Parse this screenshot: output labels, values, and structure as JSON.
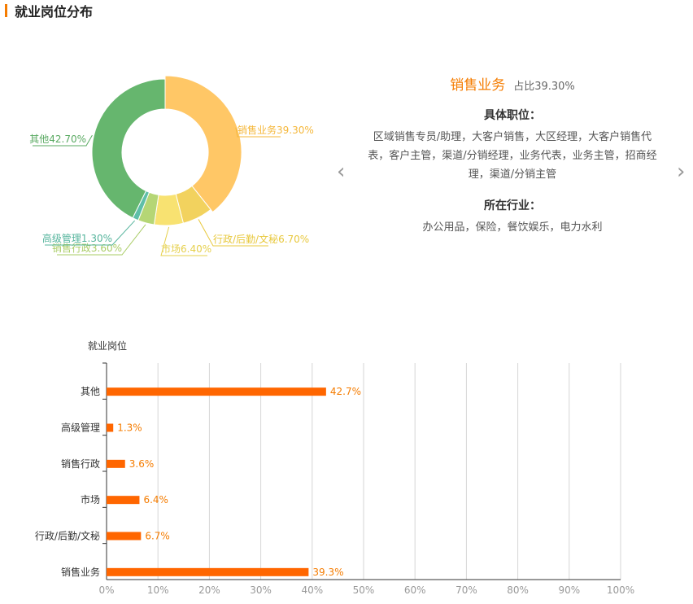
{
  "section": {
    "title": "就业岗位分布"
  },
  "colors": {
    "accent": "#f57c00",
    "bar": "#ff6600"
  },
  "chart_data": [
    {
      "type": "pie",
      "variant": "donut",
      "slices": [
        {
          "name": "销售业务",
          "value": 39.3,
          "label": "销售业务39.30%",
          "color": "#ffc766",
          "label_color": "#f5b73a"
        },
        {
          "name": "行政/后勤/文秘",
          "value": 6.7,
          "label": "行政/后勤/文秘6.70%",
          "color": "#f2d25e",
          "label_color": "#e8c83c"
        },
        {
          "name": "市场",
          "value": 6.4,
          "label": "市场6.40%",
          "color": "#f8e271",
          "label_color": "#e6d04c"
        },
        {
          "name": "销售行政",
          "value": 3.6,
          "label": "销售行政3.60%",
          "color": "#b5d675",
          "label_color": "#a9cc65"
        },
        {
          "name": "高级管理",
          "value": 1.3,
          "label": "高级管理1.30%",
          "color": "#5fbfa8",
          "label_color": "#55b49c"
        },
        {
          "name": "其他",
          "value": 42.7,
          "label": "其他42.70%",
          "color": "#66b66e",
          "label_color": "#5aaa62"
        }
      ]
    },
    {
      "type": "bar",
      "orientation": "horizontal",
      "ylabel": "就业岗位",
      "categories": [
        "其他",
        "高级管理",
        "销售行政",
        "市场",
        "行政/后勤/文秘",
        "销售业务"
      ],
      "values": [
        42.7,
        1.3,
        3.6,
        6.4,
        6.7,
        39.3
      ],
      "value_labels": [
        "42.7%",
        "1.3%",
        "3.6%",
        "6.4%",
        "6.7%",
        "39.3%"
      ],
      "xlim": [
        0,
        100
      ],
      "xticks": [
        "0%",
        "10%",
        "20%",
        "30%",
        "40%",
        "50%",
        "60%",
        "70%",
        "80%",
        "90%",
        "100%"
      ],
      "grid": true
    }
  ],
  "detail": {
    "title": "销售业务",
    "percent": "占比39.30%",
    "positions_heading": "具体职位：",
    "positions": "区域销售专员/助理，大客户销售，大区经理，大客户销售代表，客户主管，渠道/分销经理，业务代表，业务主管，招商经理，渠道/分销主管",
    "industry_heading": "所在行业：",
    "industries": "办公用品，保险，餐饮娱乐，电力水利",
    "prev_icon": "‹",
    "next_icon": "›"
  }
}
